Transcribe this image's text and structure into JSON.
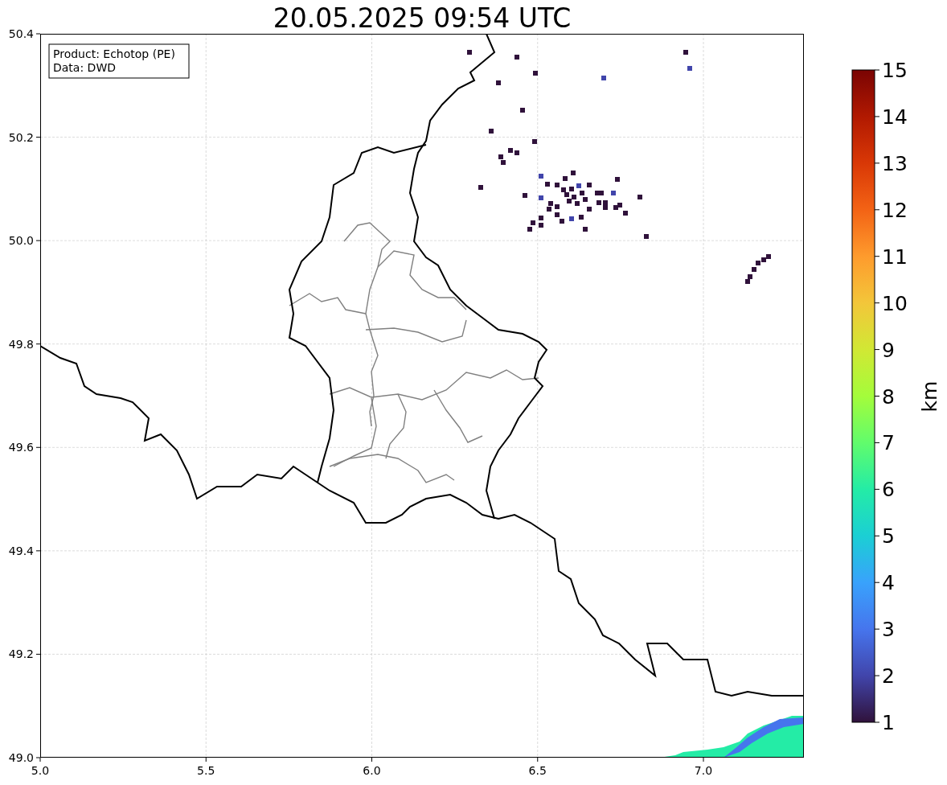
{
  "title": "20.05.2025 09:54 UTC",
  "legend": [
    "Product: Echotop (PE)",
    "Data: DWD"
  ],
  "axes": {
    "x_ticks": [
      "5.0",
      "5.5",
      "6.0",
      "6.5",
      "7.0"
    ],
    "y_ticks": [
      "50.4",
      "50.2",
      "50.0",
      "49.8",
      "49.6",
      "49.4",
      "49.2",
      "49.0"
    ]
  },
  "colorbar": {
    "label": "km",
    "ticks": [
      "15",
      "14",
      "13",
      "12",
      "11",
      "10",
      "9",
      "8",
      "7",
      "6",
      "5",
      "4",
      "3",
      "2",
      "1"
    ]
  }
}
